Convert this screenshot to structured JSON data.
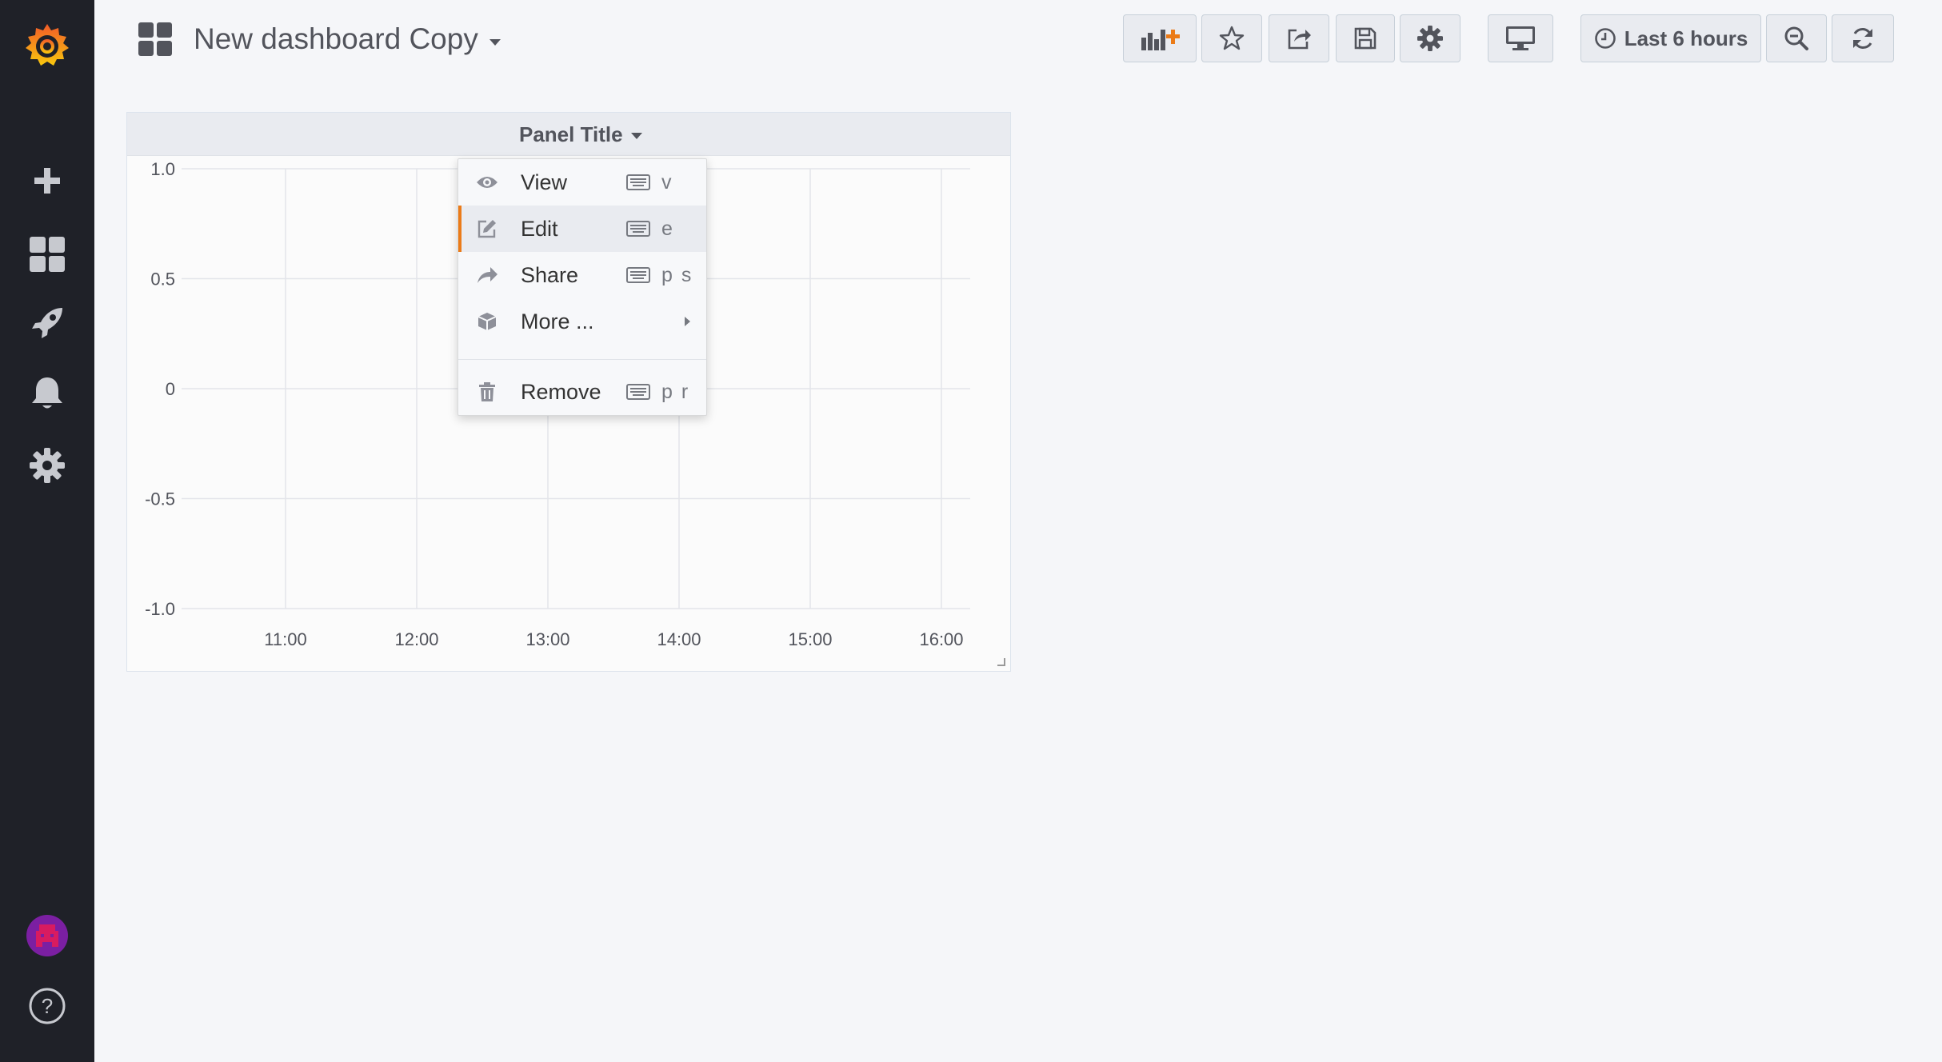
{
  "header": {
    "title": "New dashboard Copy",
    "time_range": "Last 6 hours"
  },
  "panel": {
    "title": "Panel Title"
  },
  "menu": {
    "items": [
      {
        "label": "View",
        "shortcut": "v",
        "icon": "eye-icon"
      },
      {
        "label": "Edit",
        "shortcut": "e",
        "icon": "edit-icon",
        "active": true
      },
      {
        "label": "Share",
        "shortcut": "p s",
        "icon": "share-icon"
      },
      {
        "label": "More ...",
        "icon": "cube-icon",
        "submenu": true
      },
      {
        "label": "Remove",
        "shortcut": "p r",
        "icon": "trash-icon"
      }
    ]
  },
  "chart_data": {
    "type": "line",
    "title": "",
    "xlabel": "",
    "ylabel": "",
    "x_ticks": [
      "11:00",
      "12:00",
      "13:00",
      "14:00",
      "15:00",
      "16:00"
    ],
    "y_ticks": [
      "1.0",
      "0.5",
      "0",
      "-0.5",
      "-1.0"
    ],
    "y_values": [
      1.0,
      0.5,
      0,
      -0.5,
      -1.0
    ],
    "ylim": [
      -1.0,
      1.0
    ],
    "series": [],
    "grid": true
  },
  "colors": {
    "sidebar_bg": "#1f2128",
    "accent": "#eb7b18",
    "avatar": "#7b1fa2"
  }
}
